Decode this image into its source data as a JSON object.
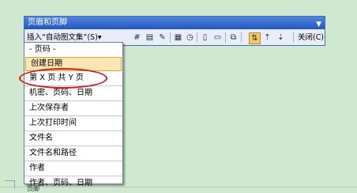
{
  "toolbar": {
    "title": "页眉和页脚",
    "insert_autotext_label": "插入“自动图文集”(S)▾",
    "close_label": "关闭(C)"
  },
  "menu": {
    "items": [
      {
        "label": "- 页码 -"
      },
      {
        "label": "创建日期"
      },
      {
        "label": "第 X 页 共 Y 页"
      },
      {
        "label": "机密、页码、日期"
      },
      {
        "label": "上次保存者"
      },
      {
        "label": "上次打印时间"
      },
      {
        "label": "文件名"
      },
      {
        "label": "文件名和路径"
      },
      {
        "label": "作者"
      },
      {
        "label": "作者、页码、日期"
      }
    ]
  },
  "footer": {
    "label": "页脚"
  },
  "colors": {
    "accent": "#2457c4",
    "highlight": "#fbe7b6",
    "annotation": "#d21d1d"
  }
}
